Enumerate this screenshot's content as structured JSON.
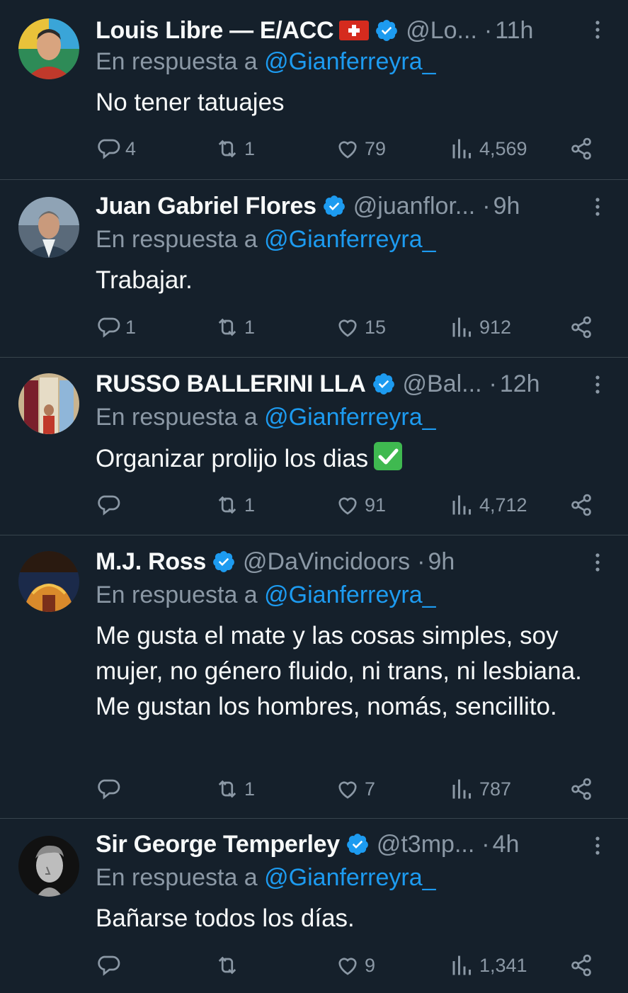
{
  "reply_prefix": "En respuesta a",
  "colors": {
    "background": "#15202b",
    "accent": "#1d9bf0",
    "muted": "#8b98a5",
    "divider": "#38444d"
  },
  "tweets": [
    {
      "name": "Louis Libre — E/ACC",
      "handle": "@Lo...",
      "time": "11h",
      "mention": "@Gianferreyra_",
      "text": "No tener tatuajes",
      "replies": "4",
      "reposts": "1",
      "likes": "79",
      "views": "4,569",
      "icons": [
        "swiss-flag-icon",
        "verified-badge-icon"
      ]
    },
    {
      "name": "Juan Gabriel Flores",
      "handle": "@juanflor...",
      "time": "9h",
      "mention": "@Gianferreyra_",
      "text": "Trabajar.",
      "replies": "1",
      "reposts": "1",
      "likes": "15",
      "views": "912",
      "icons": [
        "verified-badge-icon"
      ]
    },
    {
      "name": "RUSSO BALLERINI LLA",
      "handle": "@Bal...",
      "time": "12h",
      "mention": "@Gianferreyra_",
      "text": "Organizar prolijo los dias",
      "replies": "",
      "reposts": "1",
      "likes": "91",
      "views": "4,712",
      "icons": [
        "verified-badge-icon",
        "check-mark-emoji-icon"
      ]
    },
    {
      "name": "M.J. Ross",
      "handle": "@DaVincidoors",
      "time": "9h",
      "mention": "@Gianferreyra_",
      "text": "Me gusta el mate y las cosas simples, soy mujer, no género fluido, ni trans, ni lesbiana. Me gustan los hombres, nomás, sencillito.",
      "replies": "",
      "reposts": "1",
      "likes": "7",
      "views": "787",
      "icons": [
        "verified-badge-icon"
      ]
    },
    {
      "name": "Sir George Temperley",
      "handle": "@t3mp...",
      "time": "4h",
      "mention": "@Gianferreyra_",
      "text": "Bañarse todos los días.",
      "replies": "",
      "reposts": "",
      "likes": "9",
      "views": "1,341",
      "icons": [
        "verified-badge-icon"
      ]
    }
  ]
}
